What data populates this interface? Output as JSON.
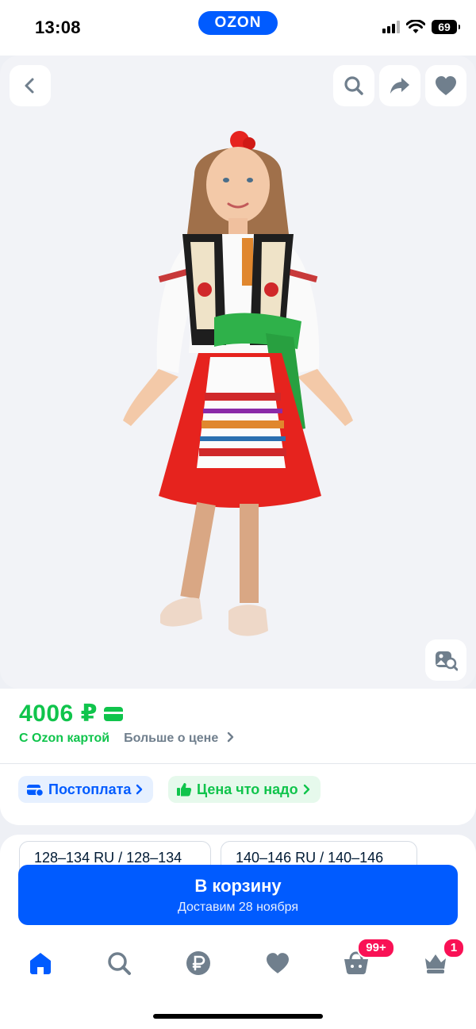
{
  "status_bar": {
    "time": "13:08",
    "logo": "OZON",
    "battery": "69",
    "icons": [
      "signal-icon",
      "wifi-icon",
      "battery-icon"
    ]
  },
  "product_image": {
    "alt": "",
    "toolbar_icons": [
      "back-icon",
      "search-icon",
      "share-icon",
      "heart-icon",
      "image-search-icon"
    ]
  },
  "price": {
    "value": "4006 ₽",
    "ozon_card_label": "С Ozon картой",
    "more_label": "Больше о цене",
    "color_accent": "#10c44c"
  },
  "chips": {
    "postpay": "Постоплата",
    "good_price": "Цена что надо"
  },
  "sizes": [
    {
      "label": "128–134 RU / 128–134"
    },
    {
      "label": "140–146 RU / 140–146"
    }
  ],
  "cart": {
    "title": "В корзину",
    "subtitle": "Доставим 28 ноября",
    "color": "#005bff"
  },
  "tab_bar": {
    "items": [
      "home-icon",
      "search-icon",
      "ruble-icon",
      "heart-icon",
      "cart-icon",
      "profile-icon"
    ],
    "cart_badge": "99+",
    "profile_badge": "1"
  }
}
